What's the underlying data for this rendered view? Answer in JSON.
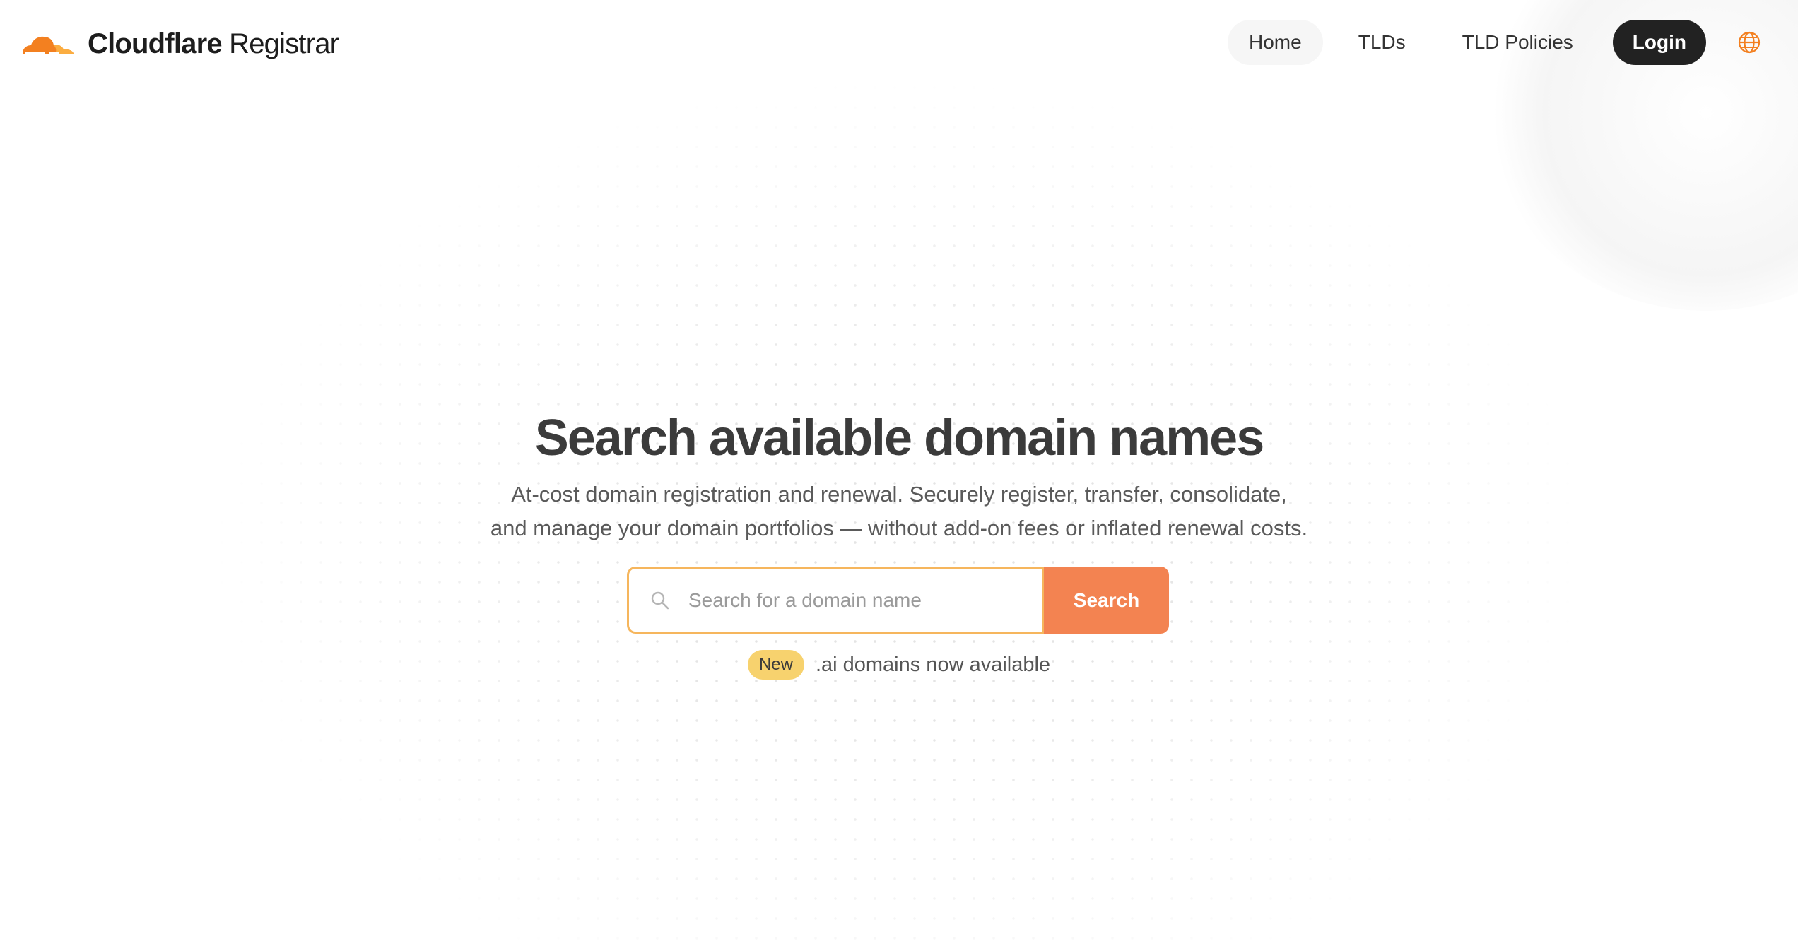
{
  "brand": {
    "name_bold": "Cloudflare",
    "name_regular": "Registrar",
    "logo_icon": "cloud-logo-icon"
  },
  "nav": {
    "items": [
      {
        "label": "Home",
        "active": true
      },
      {
        "label": "TLDs",
        "active": false
      },
      {
        "label": "TLD Policies",
        "active": false
      }
    ],
    "login_label": "Login",
    "language_icon": "globe-icon"
  },
  "hero": {
    "title": "Search available domain names",
    "subtitle_line1": "At-cost domain registration and renewal. Securely register, transfer, consolidate,",
    "subtitle_line2": "and manage your domain portfolios — without add-on fees or inflated renewal costs."
  },
  "search": {
    "placeholder": "Search for a domain name",
    "value": "",
    "button_label": "Search"
  },
  "promo": {
    "badge": "New",
    "text": ".ai domains now available"
  },
  "colors": {
    "accent_orange": "#f38351",
    "input_border": "#f6b65d",
    "badge_yellow": "#f7d26e",
    "login_bg": "#222222"
  }
}
